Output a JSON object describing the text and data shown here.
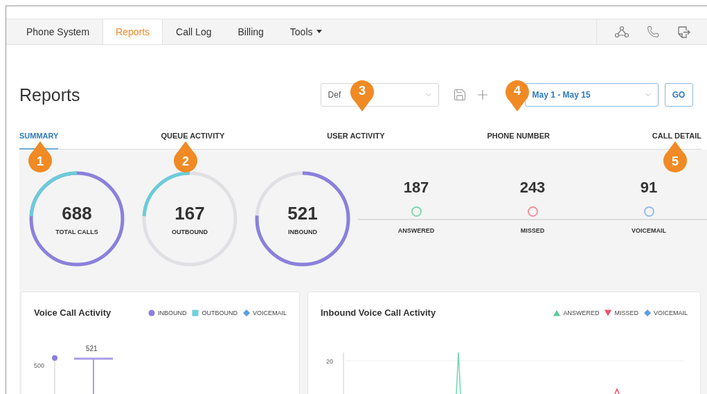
{
  "nav": {
    "items": [
      {
        "label": "Phone System",
        "selected": false,
        "menu": false
      },
      {
        "label": "Reports",
        "selected": true,
        "menu": false
      },
      {
        "label": "Call Log",
        "selected": false,
        "menu": false
      },
      {
        "label": "Billing",
        "selected": false,
        "menu": false
      },
      {
        "label": "Tools",
        "selected": false,
        "menu": true
      }
    ]
  },
  "header": {
    "title": "Reports",
    "report_select": {
      "value": "Def"
    },
    "date_select": {
      "value": "May 1 - May 15"
    },
    "go_button": "GO"
  },
  "tabs": [
    {
      "label": "SUMMARY",
      "selected": true
    },
    {
      "label": "QUEUE ACTIVITY",
      "selected": false
    },
    {
      "label": "USER ACTIVITY",
      "selected": false
    },
    {
      "label": "PHONE NUMBER",
      "selected": false
    },
    {
      "label": "CALL DETAIL",
      "selected": false
    }
  ],
  "rings": [
    {
      "kind": "total",
      "value": "688",
      "label": "TOTAL CALLS",
      "level": 0.24
    },
    {
      "kind": "outbound",
      "value": "167",
      "label": "OUTBOUND",
      "level": 0.24
    },
    {
      "kind": "inbound",
      "value": "521",
      "label": "INBOUND",
      "level": 0.76
    }
  ],
  "stats": [
    {
      "value": "187",
      "label": "ANSWERED",
      "color": "#7dd8b0"
    },
    {
      "value": "243",
      "label": "MISSED",
      "color": "#f3909b"
    },
    {
      "value": "91",
      "label": "VOICEMAIL",
      "color": "#93bbea"
    }
  ],
  "cards": [
    {
      "kind": "bars",
      "title": "Voice Call Activity",
      "legend": [
        {
          "label": "INBOUND",
          "kind": "circle",
          "color": "#8b7fdc"
        },
        {
          "label": "OUTBOUND",
          "kind": "square",
          "color": "#6fcfdc"
        },
        {
          "label": "VOICEMAIL",
          "kind": "diamond",
          "color": "#5b9de6"
        }
      ],
      "tick": "500",
      "value_label": "521"
    },
    {
      "kind": "lines",
      "title": "Inbound Voice Call Activity",
      "legend": [
        {
          "label": "ANSWERED",
          "kind": "up",
          "color": "#5cc99a"
        },
        {
          "label": "MISSED",
          "kind": "down",
          "color": "#f0506a"
        },
        {
          "label": "VOICEMAIL",
          "kind": "diamond",
          "color": "#5b9de6"
        }
      ],
      "tick": "20"
    }
  ],
  "callouts": [
    {
      "label": "1",
      "kind": "up"
    },
    {
      "label": "2",
      "kind": "up"
    },
    {
      "label": "3",
      "kind": "down"
    },
    {
      "label": "4",
      "kind": "down"
    },
    {
      "label": "5",
      "kind": "up"
    }
  ]
}
